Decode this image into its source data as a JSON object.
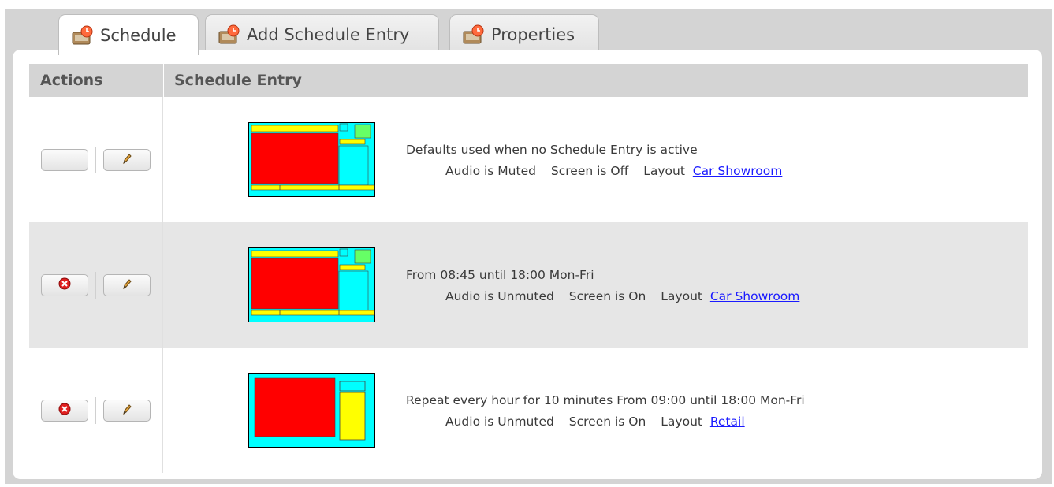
{
  "tabs": [
    {
      "label": "Schedule",
      "active": true,
      "icon": "clock-monitor-icon"
    },
    {
      "label": "Add Schedule Entry",
      "active": false,
      "icon": "clock-monitor-icon"
    },
    {
      "label": "Properties",
      "active": false,
      "icon": "clock-monitor-icon"
    }
  ],
  "table": {
    "headers": {
      "actions": "Actions",
      "entry": "Schedule Entry"
    },
    "rows": [
      {
        "delete_enabled": false,
        "title": "Defaults used when no Schedule Entry is active",
        "audio": "Audio is Muted",
        "screen": "Screen is Off",
        "layout_label": "Layout",
        "layout_name": "Car Showroom"
      },
      {
        "delete_enabled": true,
        "title": "From 08:45 until 18:00 Mon-Fri",
        "audio": "Audio is Unmuted",
        "screen": "Screen is On",
        "layout_label": "Layout",
        "layout_name": "Car Showroom"
      },
      {
        "delete_enabled": true,
        "title": "Repeat every hour for 10 minutes From 09:00 until 18:00 Mon-Fri",
        "audio": "Audio is Unmuted",
        "screen": "Screen is On",
        "layout_label": "Layout",
        "layout_name": "Retail"
      }
    ]
  },
  "colors": {
    "layout_red": "#ff0000",
    "layout_cyan": "#00ffff",
    "layout_yellow": "#ffff00",
    "layout_green": "#66ff66",
    "link": "#1a1aff",
    "delete_red": "#e02020"
  }
}
